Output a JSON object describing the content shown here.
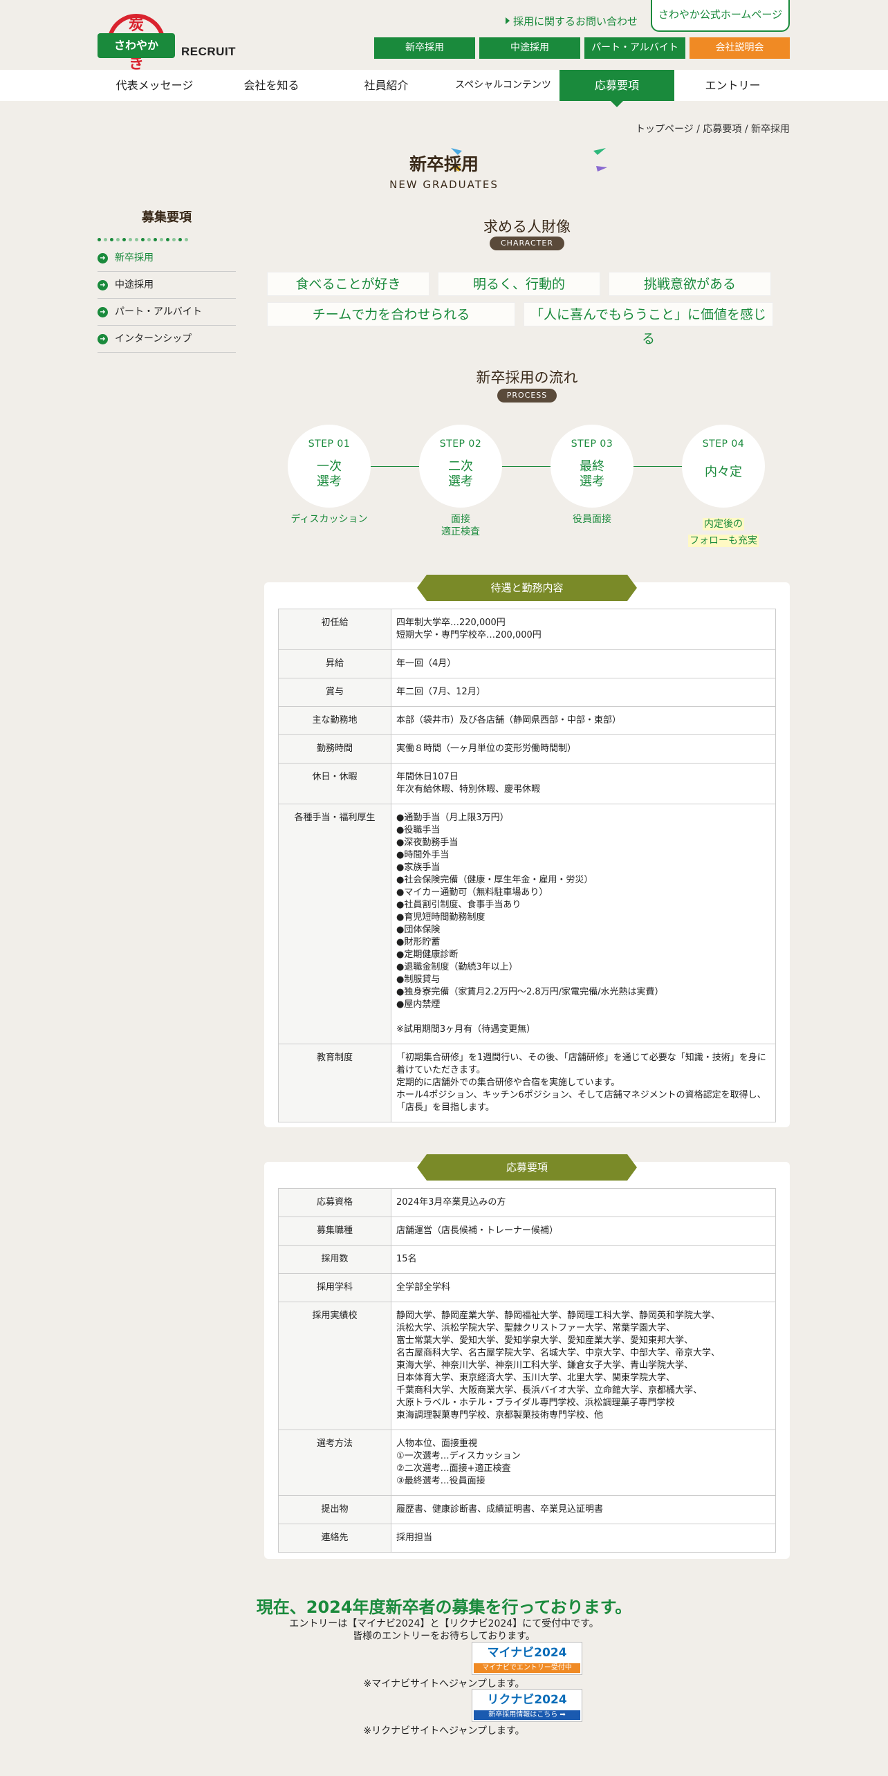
{
  "header": {
    "logo_text": "さわやか",
    "logo_mark": "炭焼き",
    "recruit_label": "RECRUIT",
    "contact_link": "採用に関するお問い合わせ",
    "official_site": "さわやか公式ホームページ",
    "buttons": [
      {
        "label": "新卒採用",
        "color": "#1a8a3c"
      },
      {
        "label": "中途採用",
        "color": "#1a8a3c"
      },
      {
        "label": "パート・アルバイト",
        "color": "#1a8a3c"
      },
      {
        "label": "会社説明会",
        "color": "#f08a24"
      }
    ]
  },
  "nav": {
    "items": [
      "代表メッセージ",
      "会社を知る",
      "社員紹介",
      "スペシャルコンテンツ",
      "応募要項",
      "エントリー"
    ],
    "active": "応募要項"
  },
  "breadcrumb": "トップページ / 応募要項 / 新卒採用",
  "page": {
    "title": "新卒採用",
    "subtitle": "NEW GRADUATES"
  },
  "sidebar": {
    "title": "募集要項",
    "items": [
      "新卒採用",
      "中途採用",
      "パート・アルバイト",
      "インターンシップ"
    ],
    "active": "新卒採用"
  },
  "character": {
    "title": "求める人財像",
    "pill": "CHARACTER",
    "traits": [
      "食べることが好き",
      "明るく、行動的",
      "挑戦意欲がある",
      "チームで力を合わせられる",
      "「人に喜んでもらうこと」に価値を感じる"
    ]
  },
  "process": {
    "title": "新卒採用の流れ",
    "pill": "PROCESS",
    "steps": [
      {
        "step": "STEP 01",
        "name_line1": "一次",
        "name_line2": "選考",
        "caption_line1": "ディスカッション",
        "caption_line2": ""
      },
      {
        "step": "STEP 02",
        "name_line1": "二次",
        "name_line2": "選考",
        "caption_line1": "面接",
        "caption_line2": "適正検査"
      },
      {
        "step": "STEP 03",
        "name_line1": "最終",
        "name_line2": "選考",
        "caption_line1": "役員面接",
        "caption_line2": ""
      },
      {
        "step": "STEP 04",
        "name_line1": "内々定",
        "name_line2": "",
        "caption_line1": "内定後の",
        "caption_line2": "フォローも充実"
      }
    ]
  },
  "conditions": {
    "title": "待遇と勤務内容",
    "rows": [
      {
        "label": "初任給",
        "value": "四年制大学卒…220,000円\n短期大学・専門学校卒…200,000円"
      },
      {
        "label": "昇給",
        "value": "年一回（4月）"
      },
      {
        "label": "賞与",
        "value": "年二回（7月、12月）"
      },
      {
        "label": "主な勤務地",
        "value": "本部（袋井市）及び各店舗（静岡県西部・中部・東部）"
      },
      {
        "label": "勤務時間",
        "value": "実働８時間（一ヶ月単位の変形労働時間制）"
      },
      {
        "label": "休日・休暇",
        "value": "年間休日107日\n年次有給休暇、特別休暇、慶弔休暇"
      },
      {
        "label": "各種手当・福利厚生",
        "value": "●通勤手当（月上限3万円）\n●役職手当\n●深夜勤務手当\n●時間外手当\n●家族手当\n●社会保険完備（健康・厚生年金・雇用・労災）\n●マイカー通勤可（無料駐車場あり）\n●社員割引制度、食事手当あり\n●育児短時間勤務制度\n●団体保険\n●財形貯蓄\n●定期健康診断\n●退職金制度（勤続3年以上）\n●制服貸与\n●独身寮完備（家賃月2.2万円～2.8万円/家電完備/水光熱は実費）\n●屋内禁煙\n\n※試用期間3ヶ月有（待遇変更無）"
      },
      {
        "label": "教育制度",
        "value": "「初期集合研修」を1週間行い、その後、「店舗研修」を通じて必要な「知識・技術」を身に着けていただきます。\n定期的に店舗外での集合研修や合宿を実施しています。\nホール4ポジション、キッチン6ポジション、そして店舗マネジメントの資格認定を取得し、「店長」を目指します。"
      }
    ]
  },
  "requirements": {
    "title": "応募要項",
    "rows": [
      {
        "label": "応募資格",
        "value": "2024年3月卒業見込みの方"
      },
      {
        "label": "募集職種",
        "value": "店舗運営（店長候補・トレーナー候補）"
      },
      {
        "label": "採用数",
        "value": "15名"
      },
      {
        "label": "採用学科",
        "value": "全学部全学科"
      },
      {
        "label": "採用実績校",
        "value": "静岡大学、静岡産業大学、静岡福祉大学、静岡理工科大学、静岡英和学院大学、\n浜松大学、浜松学院大学、聖隷クリストファー大学、常葉学園大学、\n富士常葉大学、愛知大学、愛知学泉大学、愛知産業大学、愛知東邦大学、\n名古屋商科大学、名古屋学院大学、名城大学、中京大学、中部大学、帝京大学、\n東海大学、神奈川大学、神奈川工科大学、鎌倉女子大学、青山学院大学、\n日本体育大学、東京経済大学、玉川大学、北里大学、関東学院大学、\n千葉商科大学、大阪商業大学、長浜バイオ大学、立命館大学、京都橘大学、\n大原トラベル・ホテル・ブライダル専門学校、浜松調理菓子専門学校\n東海調理製菓専門学校、京都製菓技術専門学校、他"
      },
      {
        "label": "選考方法",
        "value": "人物本位、面接重視\n①一次選考…ディスカッション\n②二次選考…面接+適正検査\n③最終選考…役員面接"
      },
      {
        "label": "提出物",
        "value": "履歴書、健康診断書、成績証明書、卒業見込証明書"
      },
      {
        "label": "連絡先",
        "value": "採用担当"
      }
    ]
  },
  "cta": {
    "headline": "現在、2024年度新卒者の募集を行っております。",
    "line1": "エントリーは【マイナビ2024】と【リクナビ2024】にて受付中です。",
    "line2": "皆様のエントリーをお待ちしております。",
    "mynavi_logo": "マイナビ2024",
    "mynavi_sub": "マイナビでエントリー受付中",
    "mynavi_note": "※マイナビサイトへジャンプします。",
    "rikunabi_logo": "リクナビ2024",
    "rikunabi_sub": "新卒採用情報はこちら ➡",
    "rikunabi_note": "※リクナビサイトへジャンプします。"
  },
  "colors": {
    "brand_green": "#1a8a3c",
    "orange": "#f08a24",
    "olive": "#7a8a28",
    "background": "#f1eee9"
  }
}
